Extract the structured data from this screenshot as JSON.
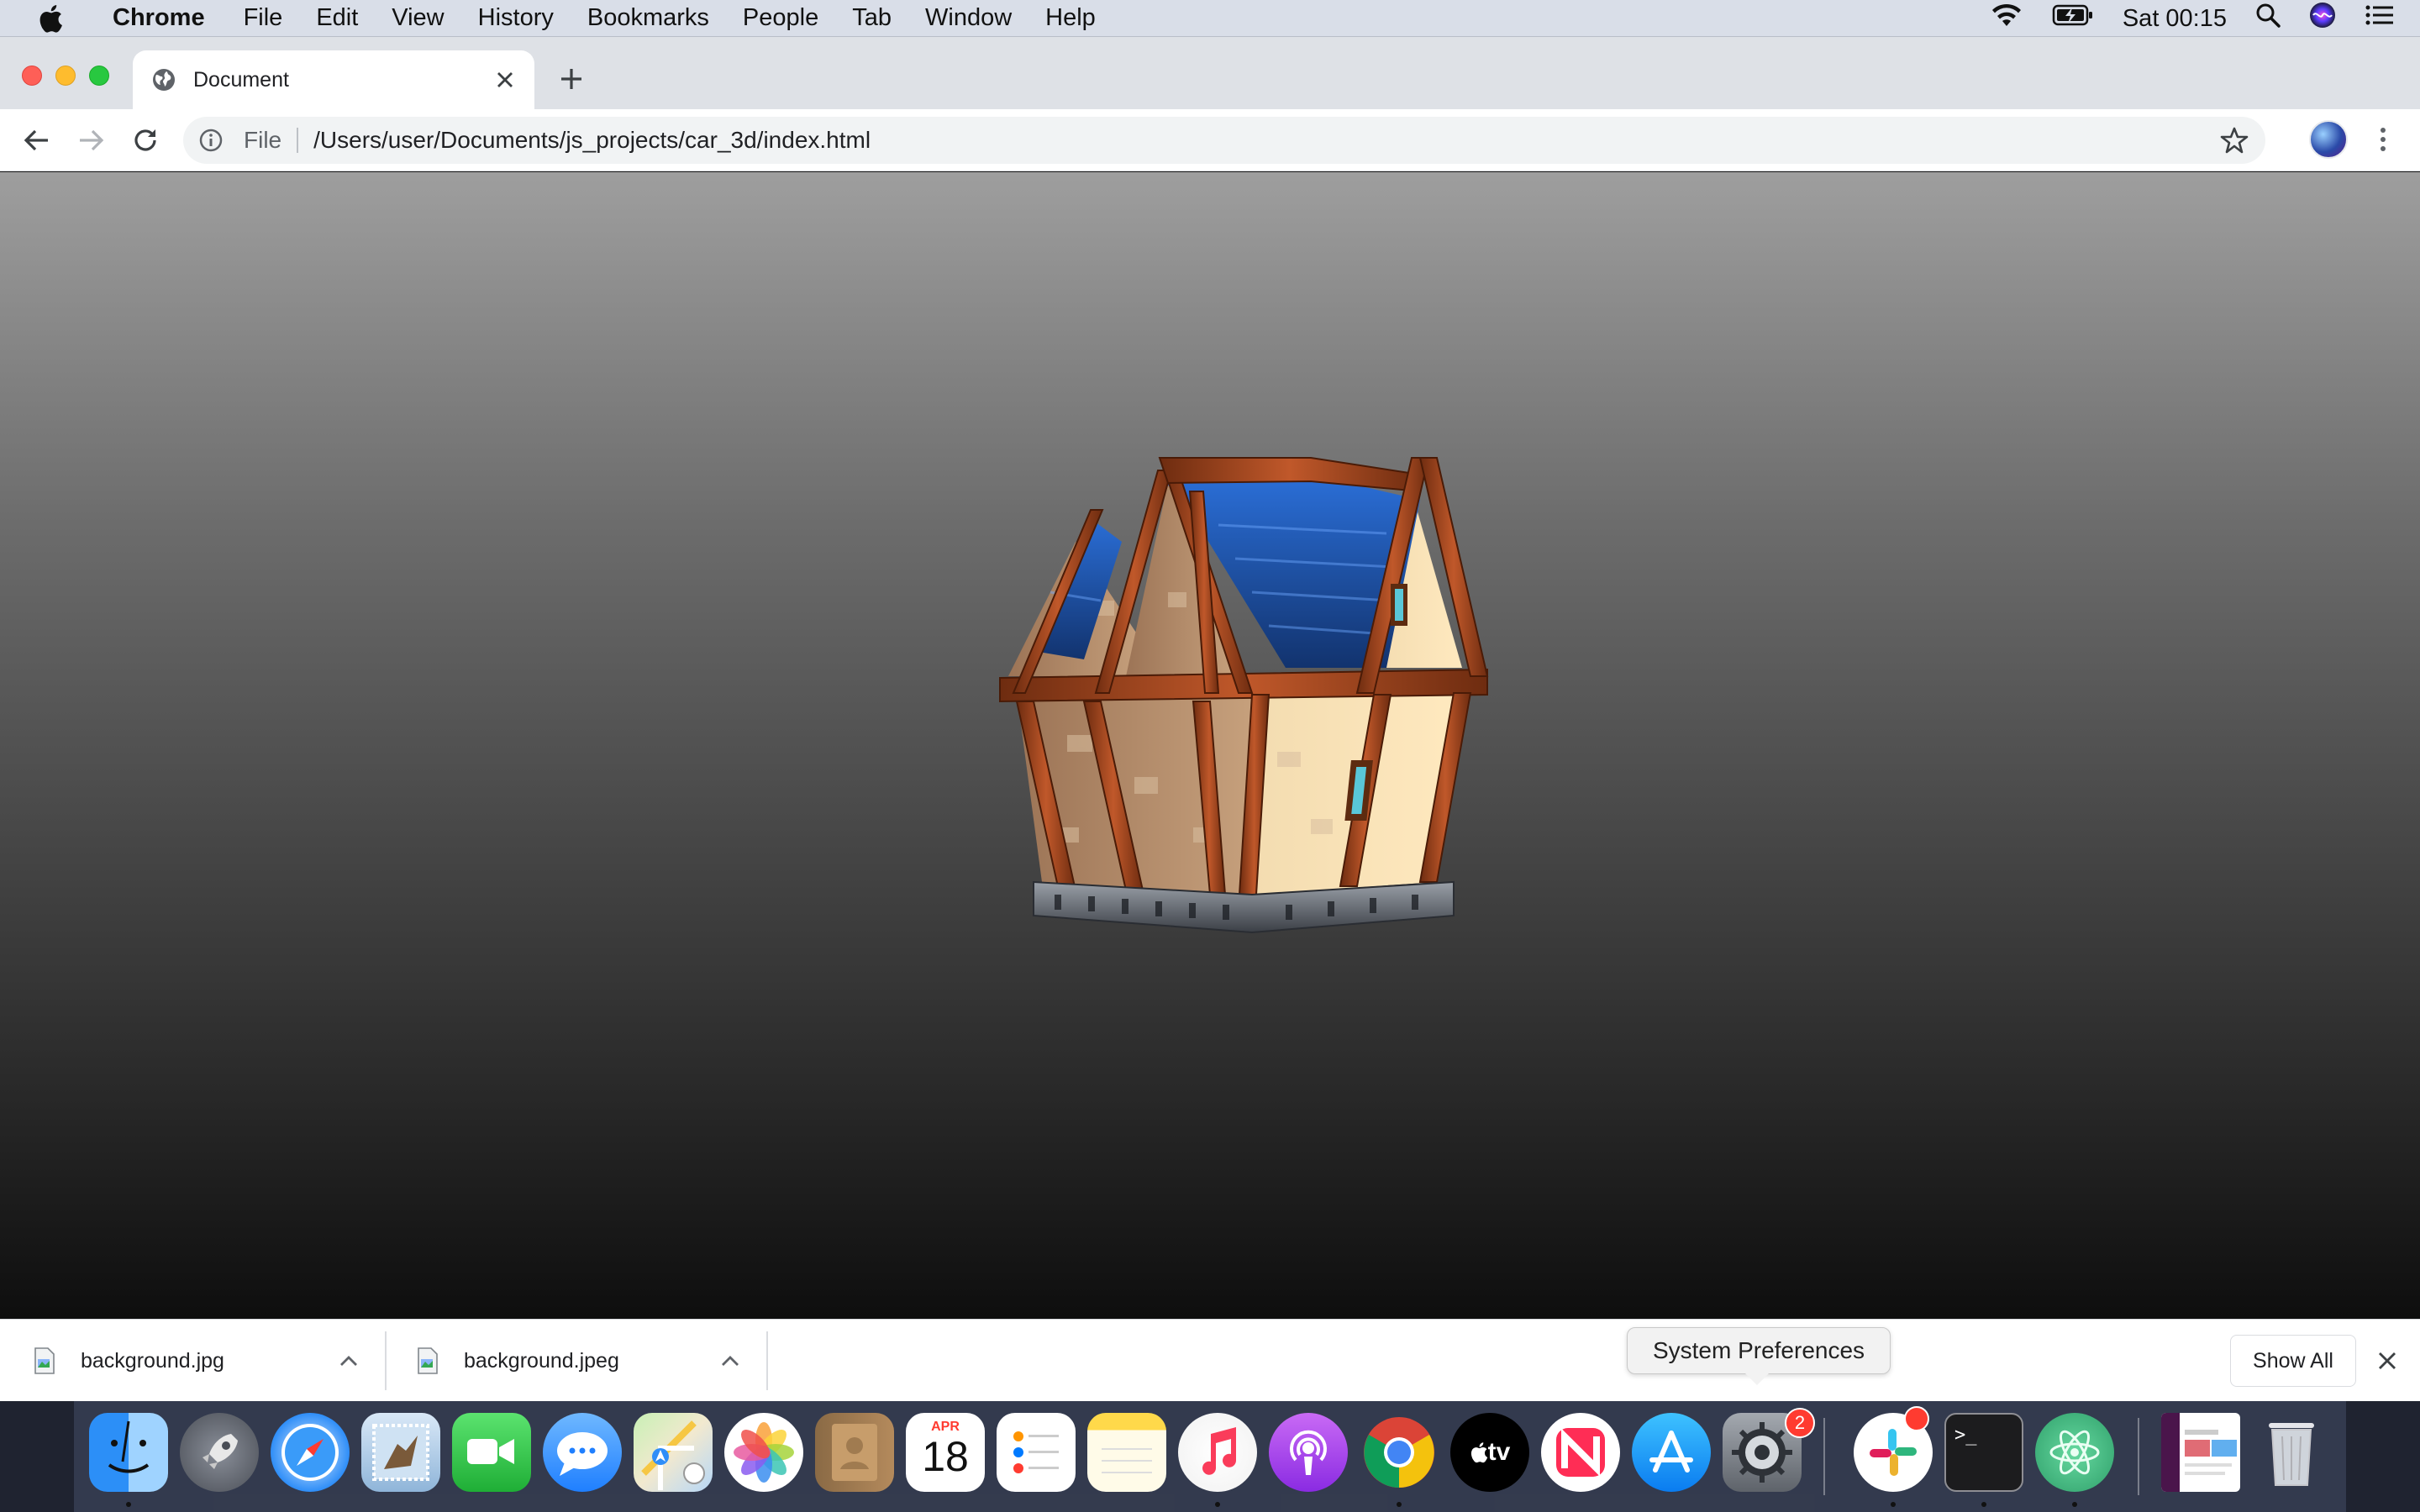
{
  "menubar": {
    "app_name": "Chrome",
    "items": [
      "File",
      "Edit",
      "View",
      "History",
      "Bookmarks",
      "People",
      "Tab",
      "Window",
      "Help"
    ],
    "clock": "Sat 00:15"
  },
  "browser": {
    "tab_title": "Document",
    "url_scheme": "File",
    "url": "/Users/user/Documents/js_projects/car_3d/index.html"
  },
  "downloads": {
    "items": [
      {
        "name": "background.jpg"
      },
      {
        "name": "background.jpeg"
      }
    ],
    "show_all_label": "Show All"
  },
  "tooltip": {
    "text": "System Preferences"
  },
  "dock": {
    "calendar_month": "APR",
    "calendar_day": "18",
    "apple_tv_label": "tv",
    "system_prefs_badge": "2",
    "terminal_prompt": ">_"
  },
  "colors": {
    "chrome_frame": "#dee1e6",
    "menubar": "#d9dee8",
    "viewport_top": "#9e9e9e",
    "viewport_bottom": "#0e0e0e"
  }
}
